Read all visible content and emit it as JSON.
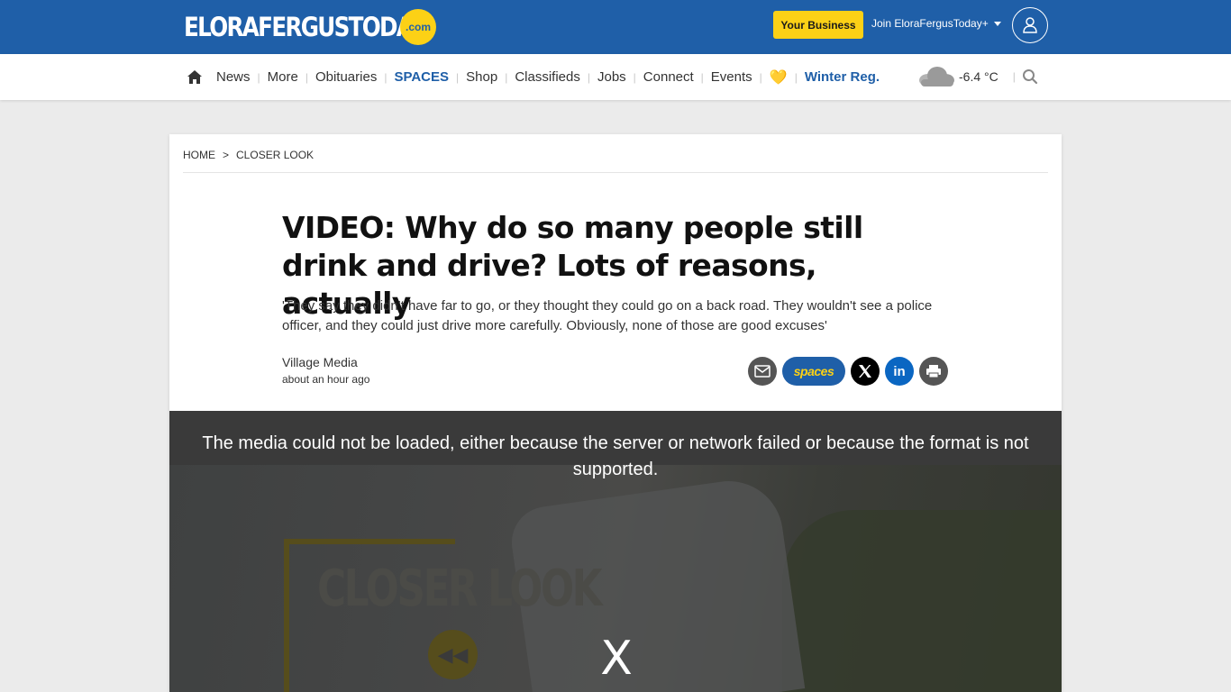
{
  "header": {
    "logo_text": "ELORAFERGUSTODAY",
    "logo_badge": ".com",
    "business_button": "Your Business",
    "join_label": "Join EloraFergusToday+",
    "brand_blue": "#1f5fa8",
    "brand_yellow": "#fcd116"
  },
  "nav": {
    "items": [
      "News",
      "More",
      "Obituaries",
      "SPACES",
      "Shop",
      "Classifieds",
      "Jobs",
      "Connect",
      "Events"
    ],
    "heart": "💛",
    "winter": "Winter Reg.",
    "weather_temp": "-6.4 °C",
    "icons": [
      "home-icon",
      "cloud-icon",
      "search-icon"
    ]
  },
  "article": {
    "breadcrumb": [
      "HOME",
      ">",
      "CLOSER LOOK"
    ],
    "title": "VIDEO: Why do so many people still drink and drive? Lots of reasons, actually",
    "dek": "'They say they didn't have far to go, or they thought they could go on a back road. They wouldn't see a police officer, and they could just drive more carefully. Obviously, none of those are good excuses'",
    "author": "Village Media",
    "time": "about an hour ago",
    "share": {
      "spaces_label": "spaces",
      "linkedin_label": "in",
      "icons": [
        "mail-icon",
        "spaces-icon",
        "x-icon",
        "linkedin-icon",
        "print-icon"
      ]
    }
  },
  "video": {
    "error_message": "The media could not be loaded, either because the server or network failed or because the format is not supported.",
    "close_label": "X",
    "overlay_text": "CLOSER LOOK"
  }
}
